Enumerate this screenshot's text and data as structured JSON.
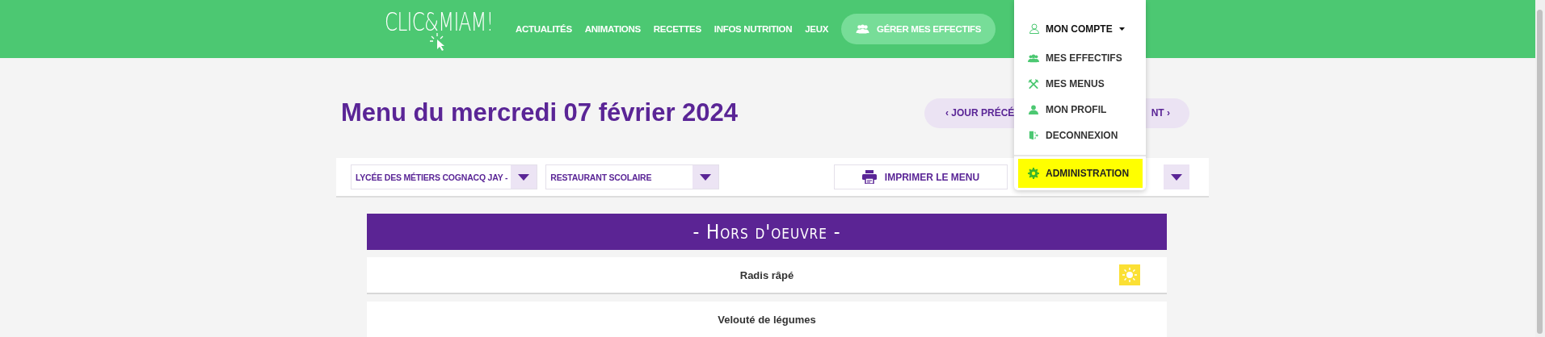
{
  "header": {
    "logo": "CLIC&MIAM!",
    "nav": [
      {
        "label": "ACTUALITÉS"
      },
      {
        "label": "ANIMATIONS"
      },
      {
        "label": "RECETTES"
      },
      {
        "label": "INFOS NUTRITION"
      },
      {
        "label": "JEUX"
      }
    ],
    "cta": "GÉRER MES EFFECTIFS"
  },
  "account_menu": {
    "label": "MON COMPTE",
    "expanded": true,
    "items": [
      {
        "label": "MES EFFECTIFS",
        "kind": "group",
        "highlighted": false
      },
      {
        "label": "MES MENUS",
        "kind": "cutlery",
        "highlighted": false
      },
      {
        "label": "MON PROFIL",
        "kind": "person",
        "highlighted": false
      },
      {
        "label": "DECONNEXION",
        "kind": "exit",
        "highlighted": false
      },
      {
        "label": "ADMINISTRATION",
        "kind": "gear",
        "highlighted": true
      }
    ]
  },
  "title": "Menu du mercredi 07 février 2024",
  "day_nav": {
    "previous": "‹ JOUR PRÉCÉ",
    "next": "NT ›"
  },
  "filters": [
    {
      "value": "LYCÉE DES MÉTIERS COGNACQ JAY -"
    },
    {
      "value": "RESTAURANT SCOLAIRE"
    }
  ],
  "print_button": "IMPRIMER LE MENU",
  "sections": [
    {
      "title": "- Hors d'oeuvre -",
      "dishes": [
        {
          "name": "Radis râpé",
          "seasonal": true
        },
        {
          "name": "Velouté de légumes",
          "seasonal": false
        }
      ]
    }
  ]
}
